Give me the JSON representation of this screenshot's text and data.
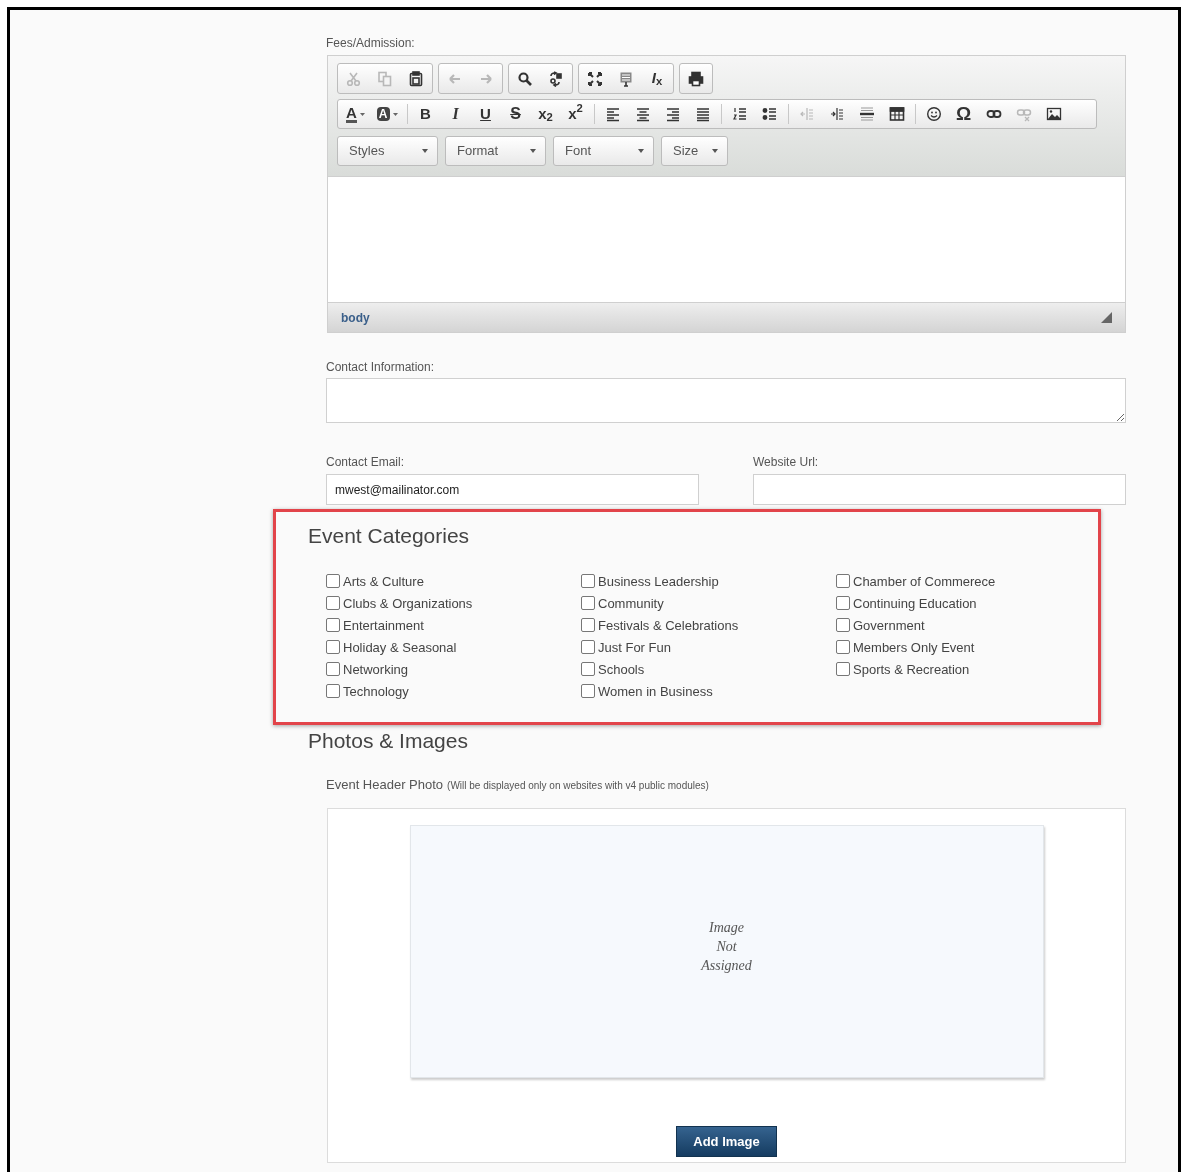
{
  "fees_label": "Fees/Admission:",
  "editor": {
    "toolbar_groups": [
      [
        {
          "kind": "icon",
          "disabled": true
        },
        {
          "kind": "icon",
          "disabled": true
        },
        {
          "kind": "icon",
          "disabled": false
        }
      ],
      [
        {
          "kind": "icon",
          "disabled": true
        },
        {
          "kind": "icon",
          "disabled": true
        }
      ],
      [
        {
          "kind": "icon",
          "disabled": false
        },
        {
          "kind": "icon",
          "disabled": false
        }
      ],
      [
        {
          "kind": "icon",
          "disabled": false
        },
        {
          "kind": "icon",
          "disabled": false
        },
        {
          "kind": "script",
          "text": "*I*$_{x}$",
          "disabled": false
        }
      ],
      [
        {
          "kind": "icon",
          "disabled": false
        }
      ]
    ],
    "format_sections": [
      [
        {
          "kind": "color",
          "text": "A",
          "disabled": false
        },
        {
          "kind": "highlight",
          "text": "A",
          "disabled": false
        }
      ],
      [
        {
          "kind": "bold",
          "text": "B",
          "disabled": false
        },
        {
          "kind": "italic",
          "text": "I",
          "disabled": false
        },
        {
          "kind": "underline",
          "text": "U",
          "disabled": false
        },
        {
          "kind": "strike",
          "text": "S",
          "disabled": false
        },
        {
          "kind": "script",
          "text": "x$_{2}$",
          "disabled": false
        },
        {
          "kind": "script",
          "text": "x$^{2}$",
          "disabled": false
        }
      ],
      [
        {
          "kind": "icon",
          "disabled": false
        },
        {
          "kind": "icon",
          "disabled": false
        },
        {
          "kind": "icon",
          "disabled": false
        },
        {
          "kind": "icon",
          "disabled": false
        }
      ],
      [
        {
          "kind": "icon",
          "disabled": false
        },
        {
          "kind": "icon",
          "disabled": false
        }
      ],
      [
        {
          "kind": "icon",
          "disabled": true
        },
        {
          "kind": "icon",
          "disabled": false
        },
        {
          "kind": "icon",
          "disabled": false
        },
        {
          "kind": "icon",
          "disabled": false
        }
      ],
      [
        {
          "kind": "icon",
          "disabled": false
        },
        {
          "kind": "glyph",
          "text": "Ω",
          "disabled": false
        },
        {
          "kind": "icon",
          "disabled": false
        },
        {
          "kind": "icon",
          "disabled": true
        },
        {
          "kind": "icon",
          "disabled": false
        }
      ]
    ],
    "combos": [
      "Styles",
      "Format",
      "Font",
      "Size"
    ],
    "path": "body"
  },
  "contact_information": {
    "label": "Contact Information:"
  },
  "contact_email": {
    "label": "Contact Email:",
    "value": "mwest@mailinator.com"
  },
  "website_url": {
    "label": "Website Url:"
  },
  "categories": {
    "title": "Event Categories",
    "columns": [
      [
        {
          "label": "Arts & Culture",
          "checked": false
        },
        {
          "label": "Clubs & Organizations",
          "checked": false
        },
        {
          "label": "Entertainment",
          "checked": false
        },
        {
          "label": "Holiday & Seasonal",
          "checked": false
        },
        {
          "label": "Networking",
          "checked": false
        },
        {
          "label": "Technology",
          "checked": false
        }
      ],
      [
        {
          "label": "Business Leadership",
          "checked": false
        },
        {
          "label": "Community",
          "checked": false
        },
        {
          "label": "Festivals & Celebrations",
          "checked": false
        },
        {
          "label": "Just For Fun",
          "checked": false
        },
        {
          "label": "Schools",
          "checked": false
        },
        {
          "label": "Women in Business",
          "checked": false
        }
      ],
      [
        {
          "label": "Chamber of Commerece",
          "checked": false
        },
        {
          "label": "Continuing Education",
          "checked": false
        },
        {
          "label": "Government",
          "checked": false
        },
        {
          "label": "Members Only Event",
          "checked": false
        },
        {
          "label": "Sports & Recreation",
          "checked": false
        }
      ]
    ]
  },
  "photos": {
    "title": "Photos & Images",
    "field_label": "Event Header Photo",
    "field_note": "(Will be displayed only on websites with v4 public modules)",
    "placeholder": "Image Not Assigned",
    "button": "Add Image"
  }
}
